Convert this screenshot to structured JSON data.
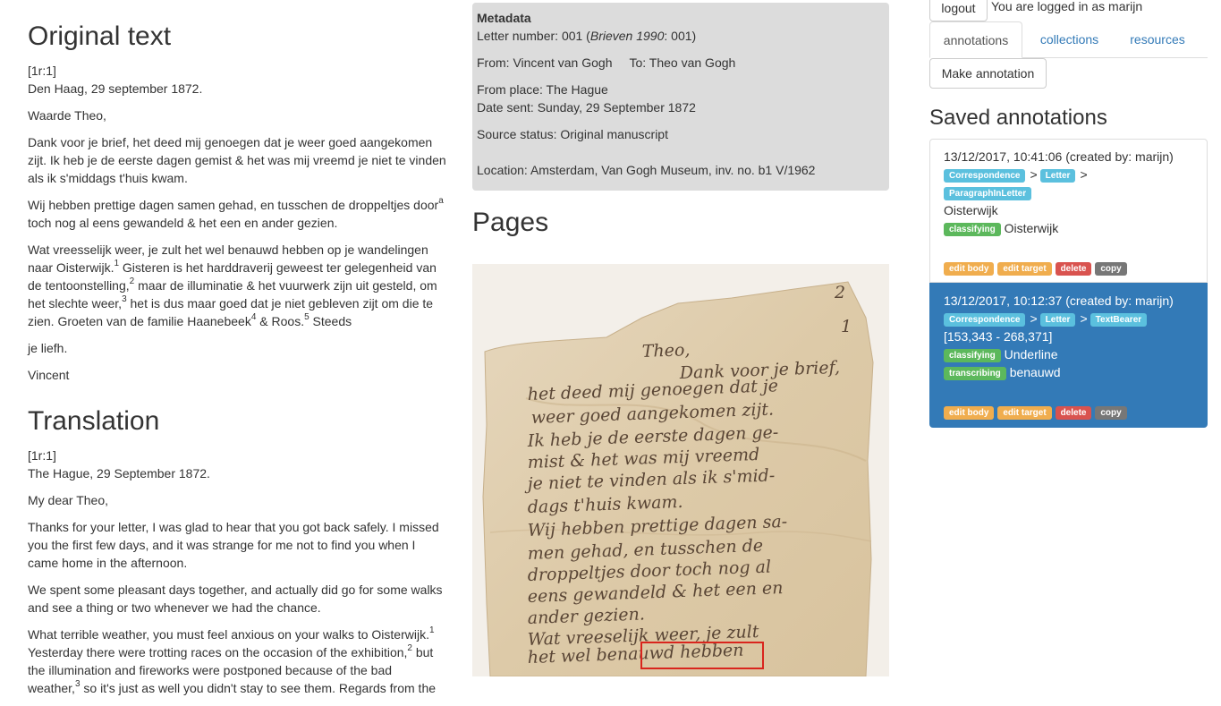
{
  "original": {
    "title": "Original text",
    "marker": "[1r:1]",
    "place_date": "Den Haag, 29 september 1872.",
    "salutation": "Waarde Theo,",
    "p1": "Dank voor je brief, het deed mij genoegen dat je weer goed aangekomen zijt. Ik heb je de eerste dagen gemist & het was mij vreemd je niet te vinden als ik s'middags t'huis kwam.",
    "p2a": "Wij hebben prettige dagen samen gehad, en tusschen de droppeltjes door",
    "p2_sup": "a",
    "p2b": " toch nog al eens gewandeld & het een en ander gezien.",
    "p3a": "Wat vreesselijk weer, je zult het wel benauwd hebben op je wandelingen naar Oisterwijk.",
    "p3_sup1": "1",
    "p3b": " Gisteren is het harddraverij geweest ter gelegenheid van de tentoonstelling,",
    "p3_sup2": "2",
    "p3c": " maar de illuminatie & het vuurwerk zijn uit gesteld, om het slechte weer,",
    "p3_sup3": "3",
    "p3d": " het is dus maar goed dat je niet gebleven zijt om die te zien. Groeten van de familie Haanebeek",
    "p3_sup4": "4",
    "p3e": " & Roos.",
    "p3_sup5": "5",
    "p3f": " Steeds",
    "closing": "je liefh.",
    "signature": "Vincent"
  },
  "translation": {
    "title": "Translation",
    "marker": "[1r:1]",
    "place_date": "The Hague, 29 September 1872.",
    "salutation": "My dear Theo,",
    "p1": "Thanks for your letter, I was glad to hear that you got back safely. I missed you the first few days, and it was strange for me not to find you when I came home in the afternoon.",
    "p2": "We spent some pleasant days together, and actually did go for some walks and see a thing or two whenever we had the chance.",
    "p3a": "What terrible weather, you must feel anxious on your walks to Oisterwijk.",
    "p3_sup1": "1",
    "p3b": " Yesterday there were trotting races on the occasion of the exhibition,",
    "p3_sup2": "2",
    "p3c": " but the illumination and fireworks were postponed because of the bad weather,",
    "p3_sup3": "3",
    "p3d": " so it's just as well you didn't stay to see them. Regards from the"
  },
  "metadata": {
    "heading": "Metadata",
    "letter_number_prefix": "Letter number: 001 (",
    "letter_number_italic": "Brieven 1990",
    "letter_number_suffix": ": 001)",
    "from": "From: Vincent van Gogh",
    "to": "To: Theo van Gogh",
    "from_place": "From place: The Hague",
    "date_sent": "Date sent: Sunday, 29 September 1872",
    "source_status": "Source status: Original manuscript",
    "location": "Location: Amsterdam, Van Gogh Museum, inv. no. b1 V/1962"
  },
  "pages": {
    "title": "Pages",
    "handwriting": [
      "Theo,",
      "Dank voor je brief,",
      "het deed mij genoegen dat je",
      "weer goed aangekomen zijt.",
      "Ik heb je de eerste dagen ge-",
      "mist & het was mij vreemd",
      "je niet te vinden als ik s'mid-",
      "dags t'huis kwam.",
      "Wij hebben prettige dagen sa-",
      "men gehad, en tusschen de",
      "droppeltjes door toch nog al",
      "eens gewandeld & het een en",
      "ander gezien.",
      "Wat vreeselijk weer, je zult",
      "het wel benauwd hebben"
    ],
    "page_mark_top": "2",
    "page_mark_bottom": "1"
  },
  "topbar": {
    "logout_label": "logout",
    "login_status": "You are logged in as marijn"
  },
  "tabs": [
    {
      "label": "annotations"
    },
    {
      "label": "collections"
    },
    {
      "label": "resources"
    }
  ],
  "make_annotation_label": "Make annotation",
  "saved_title": "Saved annotations",
  "annotations": [
    {
      "header": "13/12/2017, 10:41:06  (created by: marijn)",
      "crumb1": "Correspondence",
      "crumb2": "Letter",
      "crumb3": "ParagraphInLetter",
      "target": "Oisterwijk",
      "body1_type": "classifying",
      "body1_value": "Oisterwijk",
      "actions": [
        "edit body",
        "edit target",
        "delete",
        "copy"
      ]
    },
    {
      "header": "13/12/2017, 10:12:37  (created by: marijn)",
      "crumb1": "Correspondence",
      "crumb2": "Letter",
      "crumb3": "TextBearer",
      "target": "[153,343 - 268,371]",
      "body1_type": "classifying",
      "body1_value": "Underline",
      "body2_type": "transcribing",
      "body2_value": "benauwd",
      "actions": [
        "edit body",
        "edit target",
        "delete",
        "copy"
      ]
    }
  ],
  "colors": {
    "link": "#337ab7",
    "selected_panel": "#337ab7",
    "label_info": "#5bc0de",
    "label_success": "#5cb85c",
    "label_warning": "#f0ad4e",
    "label_danger": "#d9534f",
    "label_default": "#777777",
    "highlight_box": "#d9251d",
    "metadata_bg": "#dcdcdc"
  }
}
